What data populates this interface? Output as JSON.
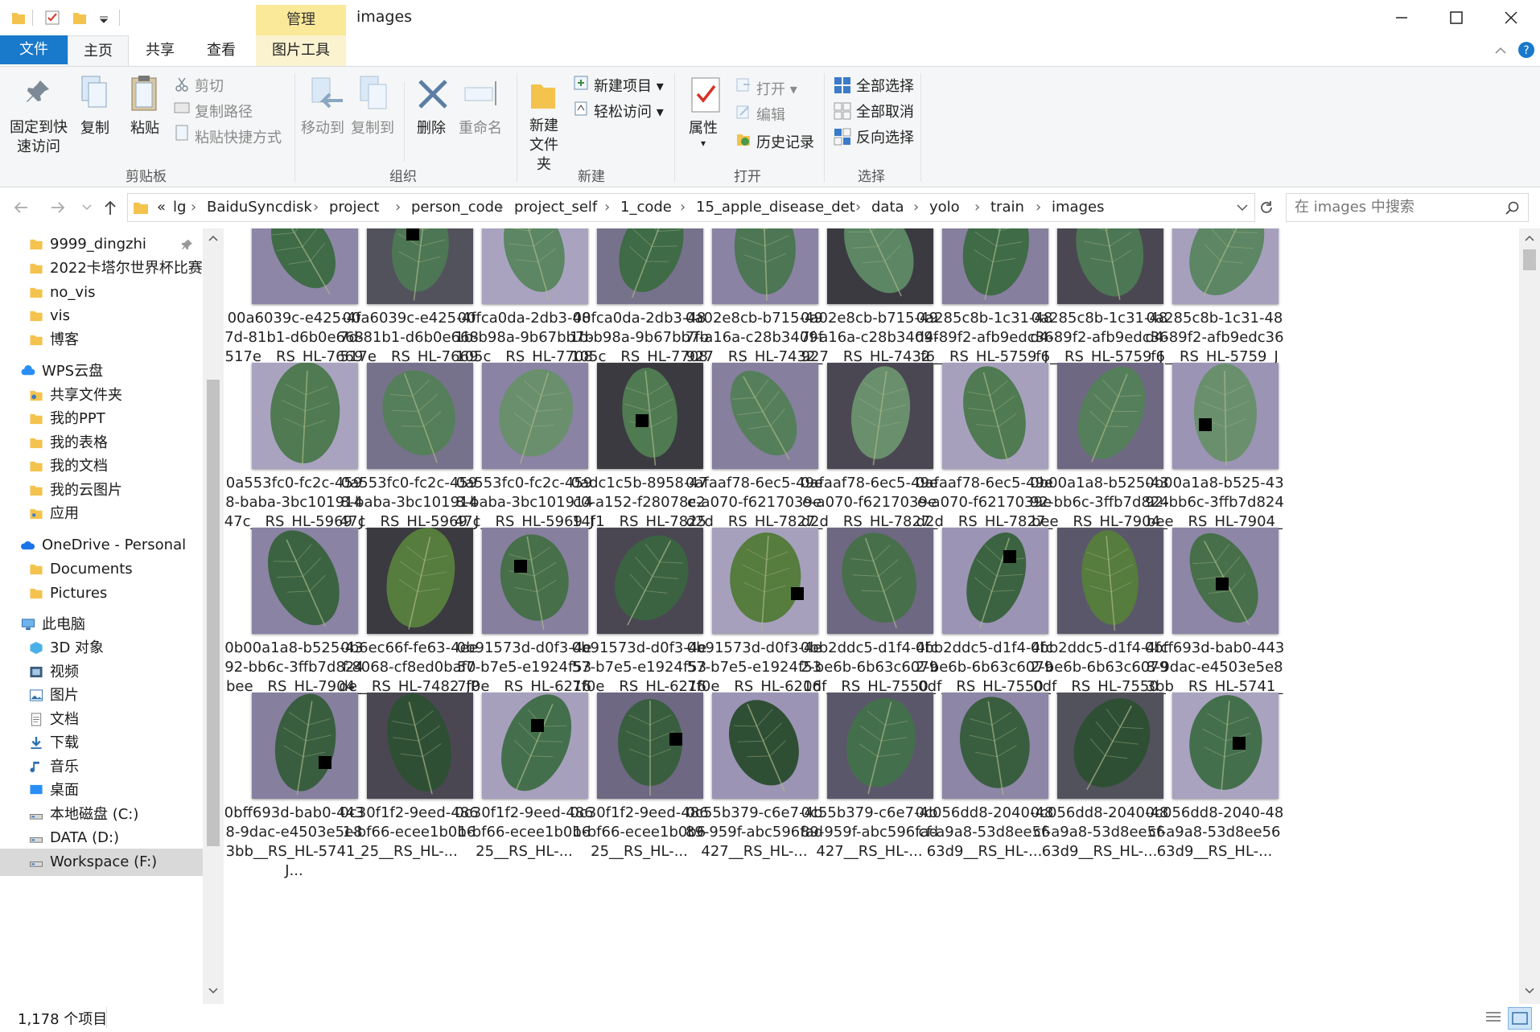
{
  "title": "images",
  "context_tab": "管理",
  "tabs": {
    "file": "文件",
    "home": "主页",
    "share": "共享",
    "view": "查看",
    "picture_tools": "图片工具"
  },
  "ribbon": {
    "pin": "固定到快速访问",
    "copy": "复制",
    "paste": "粘贴",
    "cut": "剪切",
    "copy_path": "复制路径",
    "paste_shortcut": "粘贴快捷方式",
    "clipboard": "剪贴板",
    "move_to": "移动到",
    "copy_to": "复制到",
    "delete": "删除",
    "rename": "重命名",
    "organize": "组织",
    "new_folder": "新建\n文件夹",
    "new_item": "新建项目",
    "easy_access": "轻松访问",
    "new_group": "新建",
    "properties": "属性",
    "open": "打开",
    "edit": "编辑",
    "history": "历史记录",
    "open_group": "打开",
    "select_all": "全部选择",
    "select_none": "全部取消",
    "invert_selection": "反向选择",
    "select_group": "选择"
  },
  "address": {
    "overflow": "«",
    "crumbs": [
      "lg",
      "BaiduSyncdisk",
      "project",
      "person_code",
      "project_self",
      "1_code",
      "15_apple_disease_det",
      "data",
      "yolo",
      "train",
      "images"
    ]
  },
  "search_placeholder": "在 images 中搜索",
  "sidebar": [
    {
      "label": "9999_dingzhi",
      "icon": "folder-icon",
      "pinned": true
    },
    {
      "label": "2022卡塔尔世界杯比赛",
      "icon": "folder-icon"
    },
    {
      "label": "no_vis",
      "icon": "folder-icon"
    },
    {
      "label": "vis",
      "icon": "folder-icon"
    },
    {
      "label": "博客",
      "icon": "folder-icon"
    },
    {
      "label": "WPS云盘",
      "icon": "cloud-icon",
      "root": true
    },
    {
      "label": "共享文件夹",
      "icon": "shared-folder-icon"
    },
    {
      "label": "我的PPT",
      "icon": "folder-icon"
    },
    {
      "label": "我的表格",
      "icon": "folder-icon"
    },
    {
      "label": "我的文档",
      "icon": "folder-icon"
    },
    {
      "label": "我的云图片",
      "icon": "folder-icon"
    },
    {
      "label": "应用",
      "icon": "apps-folder-icon"
    },
    {
      "label": "OneDrive - Personal",
      "icon": "onedrive-icon",
      "root": true
    },
    {
      "label": "Documents",
      "icon": "folder-icon"
    },
    {
      "label": "Pictures",
      "icon": "folder-icon"
    },
    {
      "label": "此电脑",
      "icon": "computer-icon",
      "root": true
    },
    {
      "label": "3D 对象",
      "icon": "3d-objects-icon"
    },
    {
      "label": "视频",
      "icon": "video-icon"
    },
    {
      "label": "图片",
      "icon": "pictures-icon"
    },
    {
      "label": "文档",
      "icon": "documents-icon"
    },
    {
      "label": "下载",
      "icon": "download-icon"
    },
    {
      "label": "音乐",
      "icon": "music-icon"
    },
    {
      "label": "桌面",
      "icon": "desktop-icon"
    },
    {
      "label": "本地磁盘 (C:)",
      "icon": "drive-icon"
    },
    {
      "label": "DATA (D:)",
      "icon": "drive-icon"
    },
    {
      "label": "Workspace (F:)",
      "icon": "drive-icon",
      "selected": true
    }
  ],
  "files": [
    "00a6039c-e425-4f7d-81b1-d6b0e668517e__RS_HL-7669_J...",
    "00a6039c-e425-4f7d-81b1-d6b0e668517e__RS_HL-7669_J...",
    "00fca0da-2db3-481b-b98a-9b67bb7b105c__RS_HL-7708_J...",
    "00fca0da-2db3-481b-b98a-9b67bb7b105c__RS_HL-7708_J...",
    "0a02e8cb-b715-497f-a16a-c28b3409f927__RS_HL-7432_JP...",
    "0a02e8cb-b715-497f-a16a-c28b3409f927__RS_HL-7432_JP...",
    "0a285c8b-1c31-48d4-89f2-afb9edc36f6__RS_HL-5759_JP...",
    "0a285c8b-1c31-48d4-89f2-afb9edc36f6__RS_HL-5759_JP...",
    "0a285c8b-1c31-48d4-89f2-afb9edc36f6__RS_HL-5759_JP...",
    "0a553fc0-fc2c-4598-baba-3bc10191447c__RS_HL-5969_JP...",
    "0a553fc0-fc2c-4598-baba-3bc10191447c__RS_HL-5969_JP...",
    "0a553fc0-fc2c-4598-baba-3bc10191447c__RS_HL-5969_JP...",
    "0adc1c5b-8958-47c0-a152-f28078c214f1__RS_HL-7825_JPG....",
    "0afaaf78-6ec5-49ee-a070-f6217039ed2d__RS_HL-7827_JP...",
    "0afaaf78-6ec5-49ee-a070-f6217039ed2d__RS_HL-7827_JP...",
    "0afaaf78-6ec5-49ee-a070-f6217039ed2d__RS_HL-7827_JP...",
    "0b00a1a8-b525-4392-bb6c-3ffb7d824bee__RS_HL-7904_J...",
    "0b00a1a8-b525-4392-bb6c-3ffb7d824bee__RS_HL-7904_J...",
    "0b00a1a8-b525-4392-bb6c-3ffb7d824bee__RS_HL-7904_J...",
    "0b6ec66f-fe63-4eef-8068-cf8ed0baf0de__RS_HL-7482_JPG.r...",
    "0b91573d-d0f3-4e57-b7e5-e1924f537f0e__RS_HL-6216_JP...",
    "0b91573d-d0f3-4e57-b7e5-e1924f537f0e__RS_HL-6216_JP...",
    "0b91573d-d0f3-4e57-b7e5-e1924f537f0e__RS_HL-6216_JP...",
    "0bb2ddc5-d1f4-4fc2-be6b-6b63c60790df__RS_HL-7550_J...",
    "0bb2ddc5-d1f4-4fc2-be6b-6b63c60790df__RS_HL-7550_J...",
    "0bb2ddc5-d1f4-4fc2-be6b-6b63c60790df__RS_HL-7550_J...",
    "0bff693d-bab0-4438-9dac-e4503e5e83bb__RS_HL-5741_J...",
    "0bff693d-bab0-4438-9dac-e4503e5e83bb__RS_HL-5741_J...",
    "0c30f1f2-9eed-4861-bf66-ecee1b0b625__RS_HL-...",
    "0c30f1f2-9eed-4861-bf66-ecee1b0b625__RS_HL-...",
    "0c30f1f2-9eed-4861-bf66-ecee1b0b625__RS_HL-...",
    "0c55b379-c6e7-4b89-959f-abc596fad427__RS_HL-...",
    "0c55b379-c6e7-4b89-959f-abc596fad427__RS_HL-...",
    "0c056dd8-2040-48cf-a9a8-53d8ee5663d9__RS_HL-...",
    "0c056dd8-2040-48cf-a9a8-53d8ee5663d9__RS_HL-...",
    "0c056dd8-2040-48cf-a9a8-53d8ee5663d9__RS_HL-..."
  ],
  "status": {
    "count": "1,178 个项目"
  },
  "colors": {
    "accent": "#1979ca",
    "leaf": "#3e6b44",
    "bg_purple": "#8a83a3",
    "folder": "#f4c34e"
  }
}
